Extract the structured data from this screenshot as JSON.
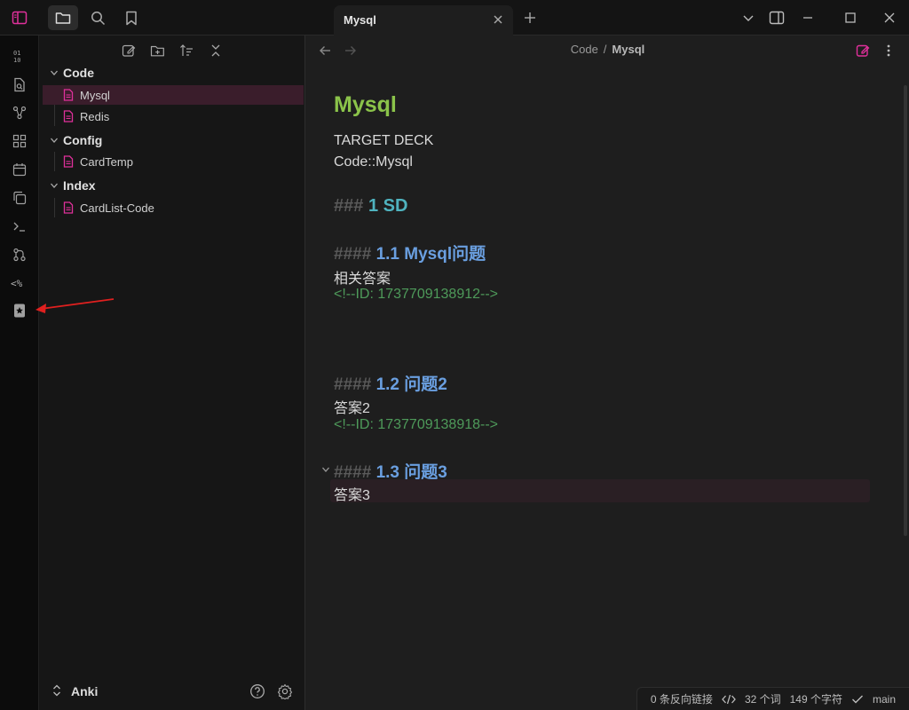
{
  "tab": {
    "title": "Mysql"
  },
  "explorer": {
    "folders": [
      {
        "label": "Code",
        "files": [
          "Mysql",
          "Redis"
        ]
      },
      {
        "label": "Config",
        "files": [
          "CardTemp"
        ]
      },
      {
        "label": "Index",
        "files": [
          "CardList-Code"
        ]
      }
    ],
    "active_file": "Mysql"
  },
  "vault": {
    "name": "Anki"
  },
  "breadcrumb": {
    "parent": "Code",
    "separator": "/",
    "current": "Mysql"
  },
  "document": {
    "title": "Mysql",
    "deck_label": "TARGET DECK",
    "deck_value": "Code::Mysql",
    "h3_hashes": "###",
    "h3_text": "1 SD",
    "h4_hashes": "####",
    "q1": "1.1 Mysql问题",
    "a1": "相关答案",
    "id1": "<!--ID: 1737709138912-->",
    "q2": "1.2 问题2",
    "a2": "答案2",
    "id2": "<!--ID: 1737709138918-->",
    "q3": "1.3 问题3",
    "a3": "答案3"
  },
  "status": {
    "backlinks": "0 条反向链接",
    "words": "32 个词",
    "chars": "149 个字符",
    "branch": "main"
  },
  "colors": {
    "accent": "#e0309b",
    "h1": "#8bc34a",
    "h3": "#4fb3bf",
    "h4": "#6a9fe0",
    "comment": "#4e9a5a",
    "annotation_arrow": "#e0201f"
  },
  "icons": {
    "titlebar": [
      "sidebar-toggle-icon",
      "folder-icon",
      "search-icon",
      "bookmark-icon"
    ],
    "ribbon": [
      "binary-icon",
      "file-search-icon",
      "graph-icon",
      "grid-icon",
      "calendar-icon",
      "copy-icon",
      "terminal-icon",
      "git-icon",
      "template-icon",
      "anki-icon"
    ]
  }
}
